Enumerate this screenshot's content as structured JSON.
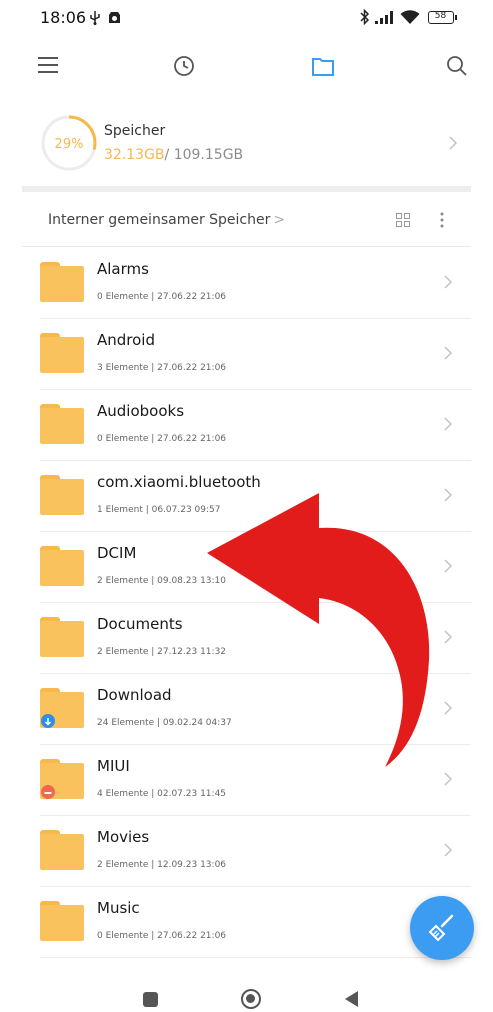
{
  "status_bar": {
    "time": "18:06",
    "battery_level": "58"
  },
  "toolbar": {
    "menu_icon": "menu-icon",
    "recent_icon": "clock-icon",
    "files_icon": "folder-icon",
    "search_icon": "search-icon",
    "active_color": "#3a9cf2"
  },
  "storage": {
    "percent": "29%",
    "percent_value": 0.29,
    "title": "Speicher",
    "used": "32.13GB",
    "total": "/ 109.15GB",
    "accent_color": "#f6b84a"
  },
  "path": {
    "label": "Interner gemeinsamer Speicher",
    "separator": ">"
  },
  "files": [
    {
      "name": "Alarms",
      "meta": "0 Elemente  |  27.06.22 21:06",
      "badge": null
    },
    {
      "name": "Android",
      "meta": "3 Elemente  |  27.06.22 21:06",
      "badge": null
    },
    {
      "name": "Audiobooks",
      "meta": "0 Elemente  |  27.06.22 21:06",
      "badge": null
    },
    {
      "name": "com.xiaomi.bluetooth",
      "meta": "1 Element  |  06.07.23 09:57",
      "badge": null
    },
    {
      "name": "DCIM",
      "meta": "2 Elemente  |  09.08.23 13:10",
      "badge": null
    },
    {
      "name": "Documents",
      "meta": "2 Elemente  |  27.12.23 11:32",
      "badge": null
    },
    {
      "name": "Download",
      "meta": "24 Elemente  |  09.02.24 04:37",
      "badge": "download"
    },
    {
      "name": "MIUI",
      "meta": "4 Elemente  |  02.07.23 11:45",
      "badge": "miui"
    },
    {
      "name": "Movies",
      "meta": "2 Elemente  |  12.09.23 13:06",
      "badge": null
    },
    {
      "name": "Music",
      "meta": "0 Elemente  |  27.06.22 21:06",
      "badge": null
    },
    {
      "name": "",
      "meta": "",
      "badge": null
    }
  ],
  "fab": {
    "icon": "broom-icon",
    "color": "#3b9cf2"
  },
  "annotation": {
    "icon": "red-curved-arrow",
    "color": "#e21b1b"
  },
  "nav": {
    "recents_icon": "square-icon",
    "home_icon": "circle-icon",
    "back_icon": "triangle-back-icon"
  }
}
